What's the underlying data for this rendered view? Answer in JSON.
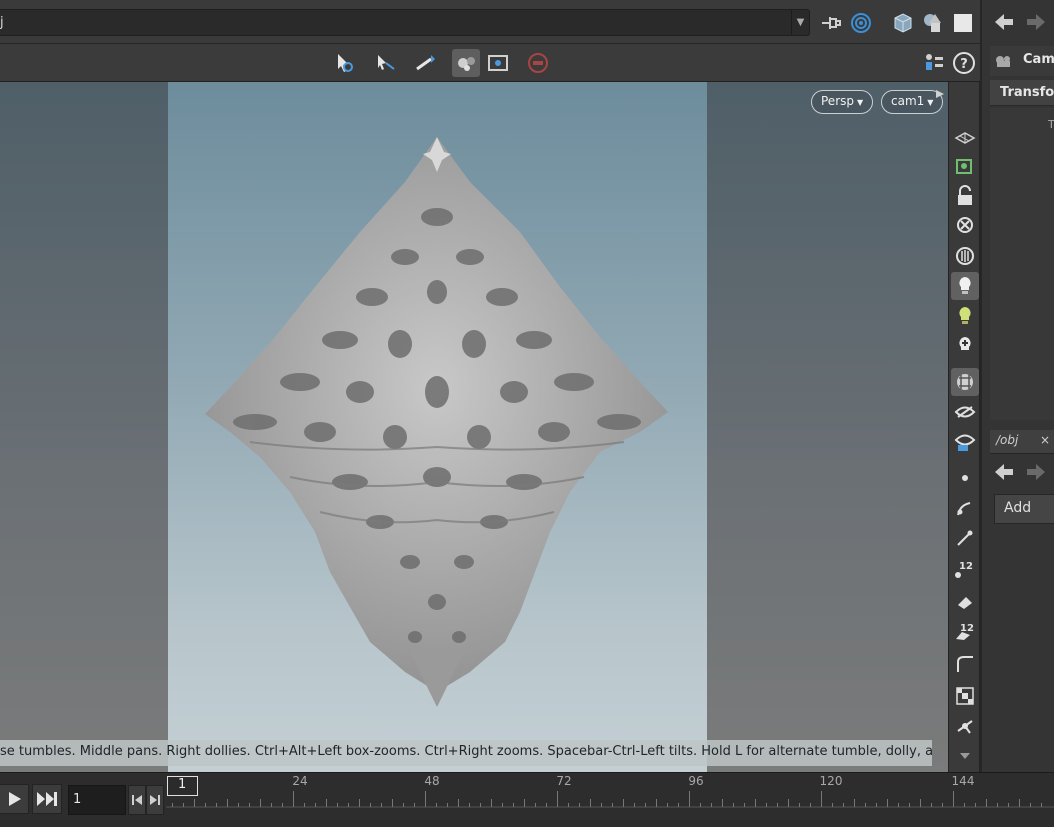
{
  "path": {
    "text": "j"
  },
  "viewport": {
    "persp_label": "Persp",
    "camera_label": "cam1",
    "status_text": "se tumbles. Middle pans. Right dollies. Ctrl+Alt+Left box-zooms. Ctrl+Right zooms. Spacebar-Ctrl-Left tilts. Hold L for alternate tumble, dolly, and zoom."
  },
  "right_panel": {
    "camera_label": "Came",
    "transform_label": "Transfor",
    "transform_field_initial": "T",
    "network_tab": "/obj",
    "close_symbol": "×",
    "add_button": "Add"
  },
  "timeline": {
    "frame_value": "1",
    "current_frame": "1",
    "ticks": [
      "24",
      "48",
      "72",
      "96",
      "120",
      "144"
    ]
  },
  "vertical_tools": {
    "snap_label_1": "12",
    "snap_label_2": "12"
  },
  "colors": {
    "accent_blue": "#3a8fd6",
    "viewport_top": "#6d8c9c",
    "viewport_bottom": "#c3cfd3"
  }
}
